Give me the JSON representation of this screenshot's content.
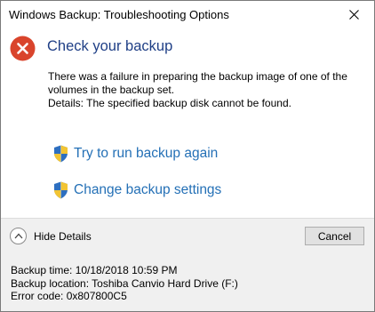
{
  "window": {
    "title": "Windows Backup: Troubleshooting Options"
  },
  "dialog": {
    "heading": "Check your backup",
    "message_lines": [
      "There was a failure in preparing the backup image of one of the",
      "volumes in the backup set.",
      "Details: The specified backup disk cannot be found."
    ],
    "links": [
      {
        "label": "Try to run backup again",
        "icon": "uac-shield-icon"
      },
      {
        "label": "Change backup settings",
        "icon": "uac-shield-icon"
      }
    ]
  },
  "footer": {
    "hide_details_label": "Hide Details",
    "cancel_label": "Cancel",
    "details": [
      "Backup time: 10/18/2018 10:59 PM",
      "Backup location: Toshiba Canvio Hard Drive (F:)",
      "Error code: 0x807800C5"
    ]
  },
  "colors": {
    "error_icon": "#d9442c",
    "heading": "#1f3f86",
    "link": "#2470b6",
    "footer_bg": "#f0f0f0"
  }
}
